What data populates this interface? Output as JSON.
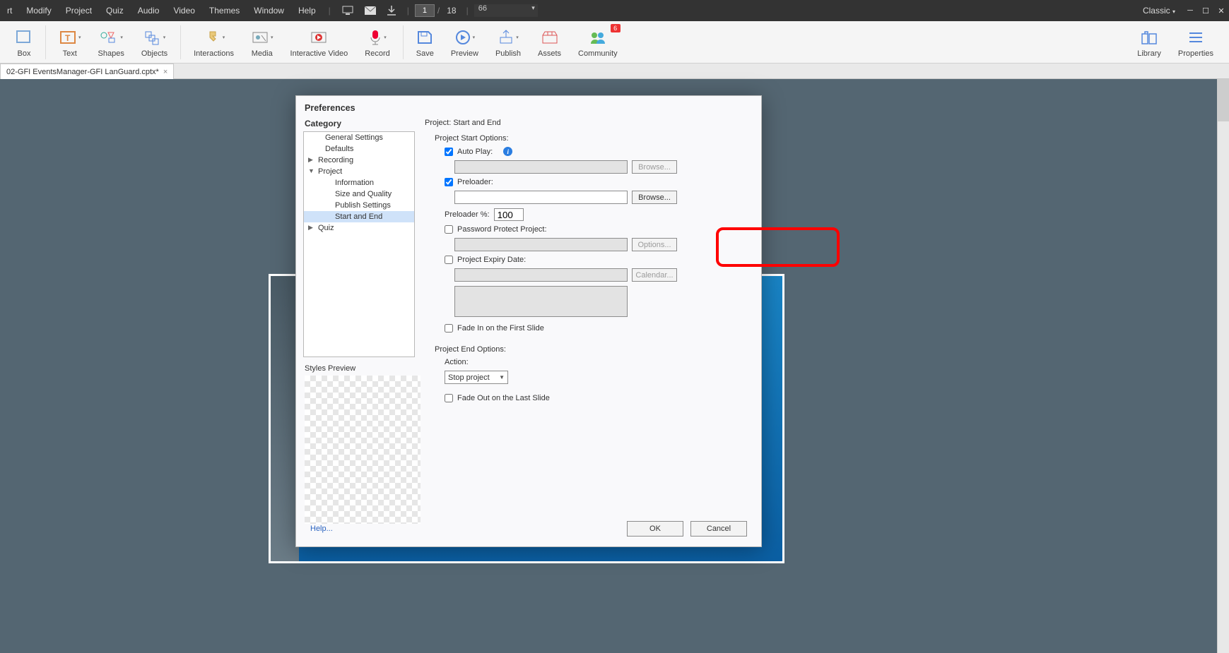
{
  "menubar": {
    "items": [
      "rt",
      "Modify",
      "Project",
      "Quiz",
      "Audio",
      "Video",
      "Themes",
      "Window",
      "Help"
    ],
    "page_current": "1",
    "page_total": "18",
    "zoom": "66",
    "workspace": "Classic"
  },
  "ribbon": {
    "groups": [
      {
        "label": "Box"
      },
      {
        "label": "Text"
      },
      {
        "label": "Shapes"
      },
      {
        "label": "Objects"
      },
      {
        "label": "Interactions"
      },
      {
        "label": "Media"
      },
      {
        "label": "Interactive Video"
      },
      {
        "label": "Record"
      },
      {
        "label": "Save"
      },
      {
        "label": "Preview"
      },
      {
        "label": "Publish"
      },
      {
        "label": "Assets"
      },
      {
        "label": "Community",
        "badge": "6"
      },
      {
        "label": "Library"
      },
      {
        "label": "Properties"
      }
    ]
  },
  "tabs": {
    "file": "02-GFI EventsManager-GFI LanGuard.cptx*"
  },
  "dialog": {
    "title": "Preferences",
    "category_label": "Category",
    "tree": {
      "general": "General Settings",
      "defaults": "Defaults",
      "recording": "Recording",
      "project": "Project",
      "information": "Information",
      "size_quality": "Size and Quality",
      "publish": "Publish Settings",
      "start_end": "Start and End",
      "quiz": "Quiz"
    },
    "styles_preview": "Styles Preview",
    "panel": {
      "title": "Project: Start and End",
      "start_options": "Project Start Options:",
      "auto_play": "Auto Play:",
      "browse": "Browse...",
      "preloader": "Preloader:",
      "preloader_pct": "Preloader %:",
      "preloader_val": "100",
      "password": "Password Protect Project:",
      "options": "Options...",
      "expiry": "Project Expiry Date:",
      "calendar": "Calendar...",
      "fade_in": "Fade In on the First Slide",
      "end_options": "Project End Options:",
      "action": "Action:",
      "action_val": "Stop project",
      "fade_out": "Fade Out on the Last Slide"
    },
    "help": "Help...",
    "ok": "OK",
    "cancel": "Cancel"
  }
}
